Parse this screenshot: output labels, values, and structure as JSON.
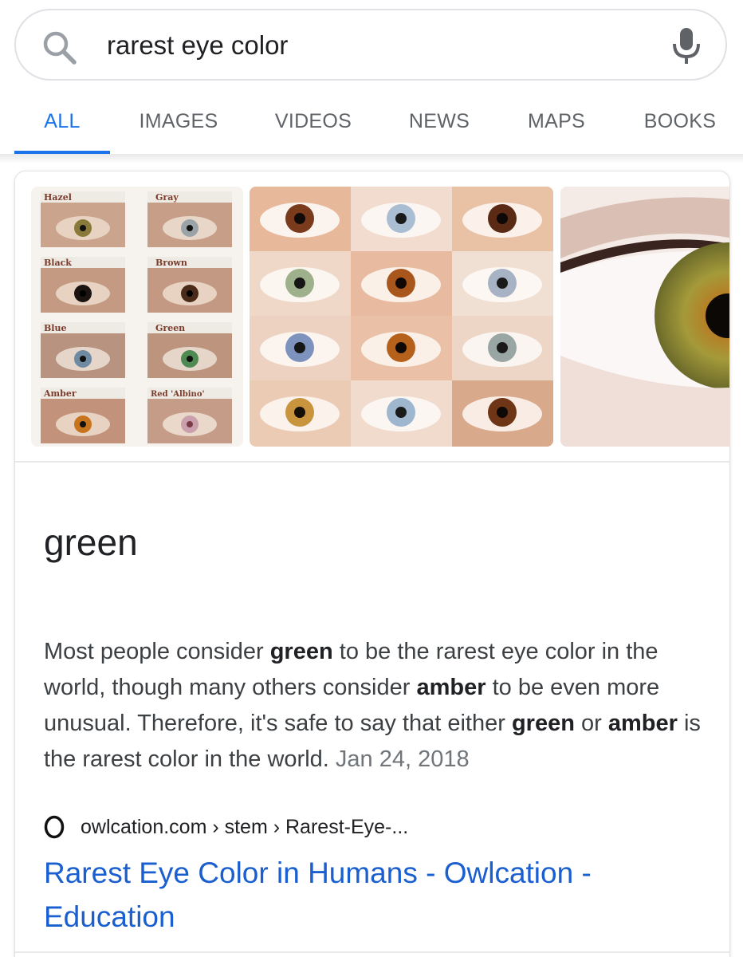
{
  "search": {
    "query": "rarest eye color",
    "search_icon": "search-icon",
    "mic_icon": "microphone-icon"
  },
  "tabs": [
    {
      "label": "ALL",
      "active": true
    },
    {
      "label": "IMAGES",
      "active": false
    },
    {
      "label": "VIDEOS",
      "active": false
    },
    {
      "label": "NEWS",
      "active": false
    },
    {
      "label": "MAPS",
      "active": false
    },
    {
      "label": "BOOKS",
      "active": false
    }
  ],
  "images": {
    "eye_chart_labels": [
      "Hazel",
      "Gray",
      "Black",
      "Brown",
      "Blue",
      "Green",
      "Amber",
      "Red 'Albino'"
    ]
  },
  "answer": {
    "title": "green",
    "text_parts": {
      "p1": "Most people consider ",
      "b1": "green",
      "p2": " to be the rarest eye color in the world, though many others consider ",
      "b2": "amber",
      "p3": " to be even more unusual. Therefore, it's safe to say that either ",
      "b3": "green",
      "p4": " or ",
      "b4": "amber",
      "p5": " is the rarest color in the world. ",
      "date": " Jan 24, 2018"
    }
  },
  "source": {
    "breadcrumb": "owlcation.com › stem › Rarest-Eye-...",
    "link_title": "Rarest Eye Color in Humans - Owlcation - Education"
  },
  "colors": {
    "accent": "#1a73e8",
    "link": "#1a5fd0",
    "tab_inactive": "#5f6368"
  }
}
